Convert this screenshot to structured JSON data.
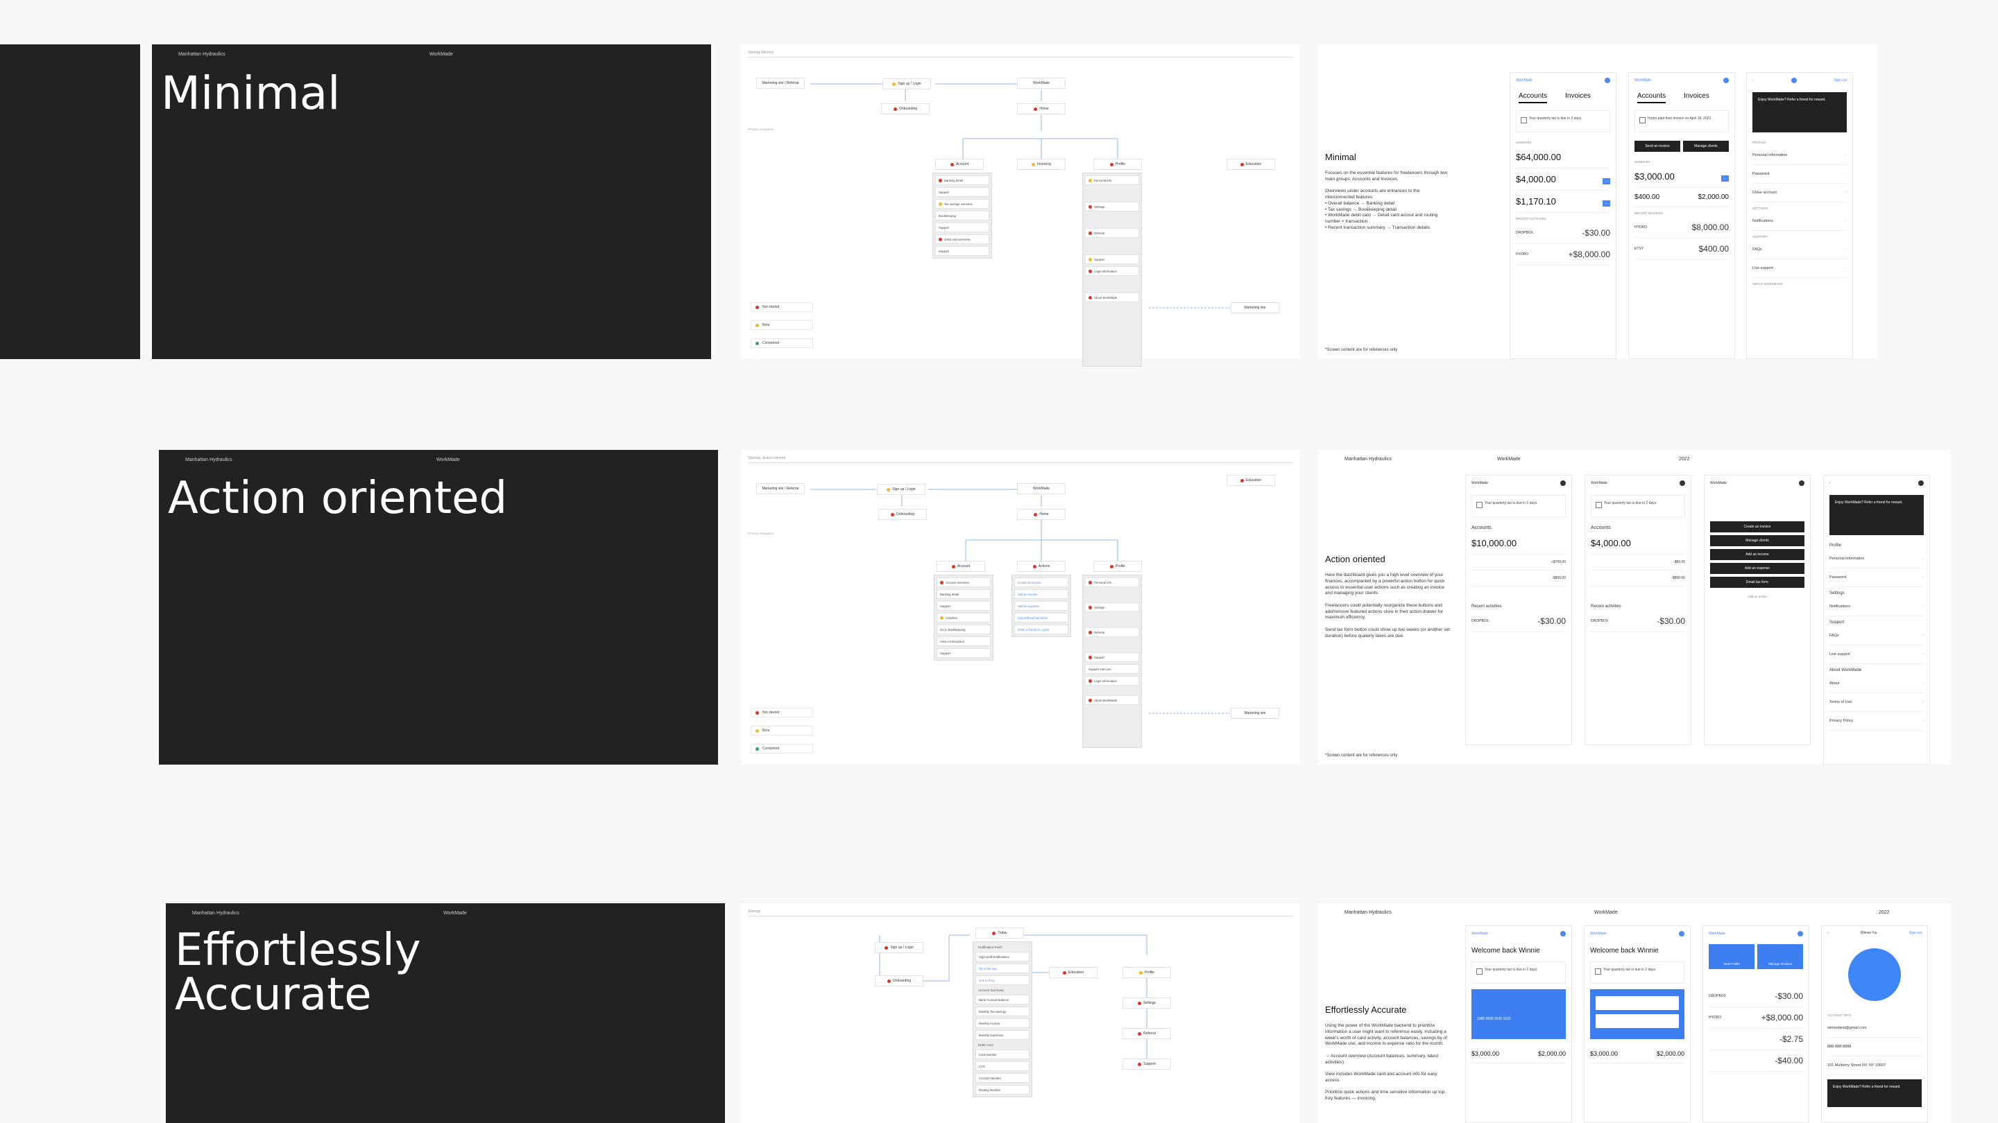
{
  "rows": [
    {
      "cover": {
        "company": "Manhattan Hydraulics",
        "brand": "WorkMade",
        "title": "Minimal"
      },
      "sitemap": {
        "label": "Sitemap Minimal",
        "primary_nav_label": "Primary navigation",
        "entry_nodes": [
          "Marketing site / Referral",
          "Sign up / Login",
          "WorkMade"
        ],
        "onboarding": "Onboarding",
        "home": "Home",
        "columns": [
          {
            "title": "Account",
            "status": "red",
            "items": [
              {
                "label": "Banking detail",
                "status": "red"
              },
              {
                "label": "Support",
                "status": ""
              },
              {
                "label": "Tax savings overview",
                "status": "yellow"
              },
              {
                "label": "Bookkeeping",
                "status": ""
              },
              {
                "label": "Support",
                "status": ""
              },
              {
                "label": "Debit card overview",
                "status": "red"
              },
              {
                "label": "Support",
                "status": ""
              }
            ]
          },
          {
            "title": "Invoicing",
            "status": "yellow",
            "items": []
          },
          {
            "title": "Profile",
            "status": "red",
            "items": [
              {
                "label": "Personal info",
                "status": "yellow"
              },
              {
                "label": "Settings",
                "status": "red"
              },
              {
                "label": "Referral",
                "status": "red"
              },
              {
                "label": "Support",
                "status": "yellow"
              },
              {
                "label": "Legal information",
                "status": "red"
              },
              {
                "label": "About WorkMade",
                "status": "red"
              }
            ]
          }
        ],
        "education": "Education",
        "marketing_site": "Marketing site",
        "legend": [
          {
            "label": "Not started",
            "status": "red"
          },
          {
            "label": "Beta",
            "status": "yellow"
          },
          {
            "label": "Completed",
            "status": "green"
          }
        ]
      },
      "concept": {
        "title": "Minimal",
        "body": "Focuses on the essential features for freelancers through two main groups: Accounts and Invoices.\n\nOverviews under accounts are entrances to the interconnected features:\n• Overall balance → Banking detail\n• Tax savings → Bookkeeping detail\n• WorkMade debit card → Detail card accout and routing number + transaction\n• Recent transaction summary → Transaction details",
        "note": "*Screen content are for references only"
      }
    },
    {
      "cover": {
        "company": "Manhattan Hydraulics",
        "brand": "WorkMade",
        "title": "Action oriented"
      },
      "sitemap": {
        "label": "Sitemap: Action oriented",
        "primary_nav_label": "Primary navigation",
        "entry_nodes": [
          "Marketing site / Referral",
          "Sign up / Login",
          "WorkMade"
        ],
        "onboarding": "Onboarding",
        "home": "Home",
        "columns": [
          {
            "title": "Account",
            "status": "red",
            "items": [
              {
                "label": "Account overview",
                "status": "red"
              },
              {
                "label": "Banking detail",
                "status": ""
              },
              {
                "label": "Support",
                "status": ""
              },
              {
                "label": "Activities",
                "status": "yellow"
              },
              {
                "label": "Go to Bookkeeping",
                "status": ""
              },
              {
                "label": "View a transaction",
                "status": ""
              },
              {
                "label": "Support",
                "status": ""
              }
            ]
          },
          {
            "title": "Actions",
            "status": "red",
            "items": [
              {
                "label": "Create an invoice",
                "status": "link"
              },
              {
                "label": "Add an income",
                "status": "link"
              },
              {
                "label": "Add an expense",
                "status": "link"
              },
              {
                "label": "Export/Email tax forms",
                "status": "link"
              },
              {
                "label": "Refer a friend for a perk",
                "status": "link"
              }
            ]
          },
          {
            "title": "Profile",
            "status": "red",
            "items": [
              {
                "label": "Personal info",
                "status": "red"
              },
              {
                "label": "Settings",
                "status": "red"
              },
              {
                "label": "Referral",
                "status": "red"
              },
              {
                "label": "Support",
                "status": "red"
              },
              {
                "label": "Support intercom",
                "status": ""
              },
              {
                "label": "Legal information",
                "status": "red"
              },
              {
                "label": "About WorkMade",
                "status": "red"
              }
            ]
          }
        ],
        "education": "Education",
        "marketing_site": "Marketing site",
        "legend": [
          {
            "label": "Not started",
            "status": "red"
          },
          {
            "label": "Beta",
            "status": "yellow"
          },
          {
            "label": "Completed",
            "status": "green"
          }
        ]
      },
      "concept": {
        "company": "Manhattan Hydraulics",
        "brand": "WorkMade",
        "year": "2022",
        "title": "Action oriented",
        "body": "Here the dashboard gives you a high level overview of your finances, accompanied by a powerful action button for quick access to essential user actions such as creating an invoice and managing your clients.\n\nFreelancers could potentially reorganize these buttons and add/remove featured actions store in their action drawer for maximum efficiency.\n\nSend tax form button could show up two weeks (or another set duration) before quaterly taxes are due.",
        "note": "*Screen content are for references only"
      }
    },
    {
      "cover": {
        "company": "Manhattan Hydraulics",
        "brand": "WorkMade",
        "title": "Effortlessly\nAccurate"
      },
      "sitemap": {
        "label": "Sitemap",
        "sign_up": "Sign up / Login",
        "onboarding": "Onboarding",
        "today": "Today",
        "education": "Education",
        "profile": "Profile",
        "settings": "Settings",
        "referral": "Referral",
        "support": "Support",
        "today_groups": [
          {
            "title": "Notification Feed",
            "items": [
              "High-yield Notifications",
              "Tip of the day",
              "Link to FAQ"
            ]
          },
          {
            "title": "Account Summary",
            "items": [
              "Bank Account Balance",
              "Monthly Tax Savings",
              "Monthly Income",
              "Monthly Expenses"
            ]
          },
          {
            "title": "Debit Card",
            "items": [
              "Card Number",
              "CVV",
              "Account Number",
              "Routing Number"
            ]
          }
        ]
      },
      "concept": {
        "company": "Manhattan Hydraulics",
        "brand": "WorkMade",
        "year": "2022",
        "title": "Effortlessly Accurate",
        "body": "Using the power of the WorkMade backend to prioritize information a user might want to reference easily. Including a week's worth of card activity, account balances, savings by of WorkMade use, and income to expense ratio for the month.\n\n→ Account overview (Account balances, summary, latest activities)\n\nView includes WorkMade card and account info for easy access.\n\nPrioritize quick actions and time sensitive information up top. Key features — invoicing,"
      }
    }
  ],
  "screens": {
    "brand": "WorkMade",
    "tabs": [
      "Accounts",
      "Invoices"
    ],
    "tax_notice": "Your quarterly tax is due in 2 days.",
    "invoice_notice": "Hydro paid their invoice on April 18, 2022.",
    "summary_label": "SUMMARY",
    "balance": "$64,000.00",
    "tax_saved": "$4,000.00",
    "card_spend": "$1,170.10",
    "recent_activities": "RECENT ACTIVITIES",
    "activity_1": {
      "name": "DROPBOX",
      "amount": "-$30.00"
    },
    "activity_2": {
      "name": "HYDRO",
      "amount": "+$8,000.00"
    },
    "send_invoice": "Send an invoice",
    "manage_clients": "Manage clients",
    "invoice_total": "$3,000.00",
    "invoice_a": "$400.00",
    "invoice_b": "$2,000.00",
    "recent_invoices": "RECENT INVOICES",
    "inv_1": {
      "name": "HYDRO",
      "amount": "$8,000.00"
    },
    "inv_2": {
      "name": "ETSY",
      "amount": "$400.00"
    },
    "referral_card": "Enjoy WorkMade? Refer a friend for reward.",
    "profile_label": "PROFILE",
    "profile_items": [
      "Personal information",
      "Password",
      "Close account"
    ],
    "settings_label": "SETTINGS",
    "notifications": "Notifications",
    "support_label": "SUPPORT",
    "support_items": [
      "FAQs",
      "Live support"
    ],
    "about_label": "ABOUT WORKMADE",
    "ao_accounts": "Accounts",
    "ao_balance": "$10,000.00",
    "ao_income": "+$700.00",
    "ao_expense": "-$800.00",
    "ao_balance_2": "$4,000.00",
    "ao_office": "-$80.00",
    "ao_contract": "-$800.00",
    "ao_recent": "Recent activities",
    "ao_dropbox": "-$30.00",
    "ao_actions": [
      "Create an invoice",
      "Manage clients",
      "Add an income",
      "Add an expense",
      "Email tax form"
    ],
    "ao_add_action": "Add an action",
    "ao_profile_items": [
      "Profile",
      "Personal information",
      "Password",
      "Settings",
      "Notifications",
      "Support",
      "FAQs",
      "Live support",
      "About WorkMade",
      "About",
      "Terms of Use",
      "Privacy Policy"
    ],
    "ea_welcome": "Welcome back Winnie",
    "ea_card_number": "1385 9999 2530 1022",
    "ea_acct_1": "$3,000.00",
    "ea_acct_2": "$2,000.00",
    "ea_quick_1": "View Profile",
    "ea_quick_2": "Manage Invoices",
    "ea_act_1": "-$30.00",
    "ea_act_2": "+$8,000.00",
    "ea_act_3": "-$2.75",
    "ea_act_4": "-$40.00",
    "ea_user": "Winnie Yiu",
    "ea_sign_out": "Sign out",
    "ea_account_info": "ACCOUNT INFO",
    "ea_email": "winniebest@gmail.com",
    "ea_phone": "888-888-8888",
    "ea_address": "101 Mulberry Street NY, NY 10607"
  },
  "colors": {
    "background": "#f7f8fa",
    "cover": "#222222",
    "accent": "#3d7ff0",
    "red": "#d9342b",
    "yellow": "#f2b92c",
    "green": "#2ea86b"
  }
}
